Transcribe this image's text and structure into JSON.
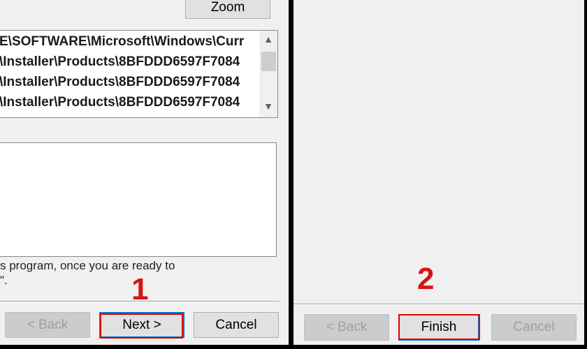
{
  "left_dialog": {
    "zoom_label": "Zoom",
    "registry_keys": [
      "E\\SOFTWARE\\Microsoft\\Windows\\Curr",
      "\\Installer\\Products\\8BFDDD6597F7084",
      "\\Installer\\Products\\8BFDDD6597F7084",
      "\\Installer\\Products\\8BFDDD6597F7084"
    ],
    "hint_line_1": "s program, once you are ready to",
    "hint_line_2": "\".",
    "back_label": "< Back",
    "next_label": "Next >",
    "cancel_label": "Cancel",
    "step_number": "1"
  },
  "right_dialog": {
    "back_label": "< Back",
    "finish_label": "Finish",
    "cancel_label": "Cancel",
    "step_number": "2"
  },
  "icons": {
    "scroll_up": "▲",
    "scroll_down": "▼"
  },
  "colors": {
    "highlight": "#e00000",
    "step_number": "#d81414",
    "focus": "#0078d7"
  }
}
